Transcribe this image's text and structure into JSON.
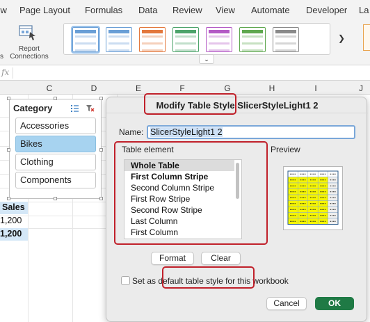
{
  "ribbon_tabs": [
    "View",
    "Page Layout",
    "Formulas",
    "Data",
    "Review",
    "View",
    "Automate",
    "Developer",
    "La"
  ],
  "ribbon": {
    "report_connections_label": "Report Connections",
    "left_cut_label": "s",
    "gallery_more_icon": "chevron-down-icon",
    "gallery_next_icon": "chevron-right-icon",
    "table_styles": [
      {
        "color": "#6a9fd6"
      },
      {
        "color": "#6a9fd6"
      },
      {
        "color": "#e3783c"
      },
      {
        "color": "#4da46b"
      },
      {
        "color": "#b45ac5"
      },
      {
        "color": "#5fa84f"
      },
      {
        "color": "#8a8a8a"
      }
    ]
  },
  "formula_bar": {
    "fx_label": "fx"
  },
  "sheet": {
    "column_headers": [
      "C",
      "D",
      "E",
      "F",
      "G",
      "H",
      "I",
      "J"
    ],
    "cells": {
      "header": "Sales",
      "value1": "1,200",
      "value2": "1,200"
    }
  },
  "slicer": {
    "title": "Category",
    "items": [
      {
        "label": "Accessories",
        "selected": false
      },
      {
        "label": "Bikes",
        "selected": true
      },
      {
        "label": "Clothing",
        "selected": false
      },
      {
        "label": "Components",
        "selected": false
      }
    ]
  },
  "dialog": {
    "title": "Modify Table Style SlicerStyleLight1 2",
    "name_label": "Name:",
    "name_value": "SlicerStyleLight1 2",
    "table_element_label": "Table element",
    "preview_label": "Preview",
    "table_elements": [
      {
        "label": "Whole Table",
        "bold": true,
        "selected": true
      },
      {
        "label": "First Column Stripe",
        "bold": true,
        "selected": false
      },
      {
        "label": "Second Column Stripe",
        "bold": false,
        "selected": false
      },
      {
        "label": "First Row Stripe",
        "bold": false,
        "selected": false
      },
      {
        "label": "Second Row Stripe",
        "bold": false,
        "selected": false
      },
      {
        "label": "Last Column",
        "bold": false,
        "selected": false
      },
      {
        "label": "First Column",
        "bold": false,
        "selected": false
      }
    ],
    "format_button": "Format",
    "clear_button": "Clear",
    "default_checkbox_label": "Set as default table style for this workbook",
    "default_checked": false,
    "cancel_button": "Cancel",
    "ok_button": "OK"
  },
  "colors": {
    "accent_green": "#1f7a45",
    "annotation_red": "#c0202a",
    "slicer_selected": "#a7d3f0",
    "preview_yellow": "#f5f500"
  }
}
